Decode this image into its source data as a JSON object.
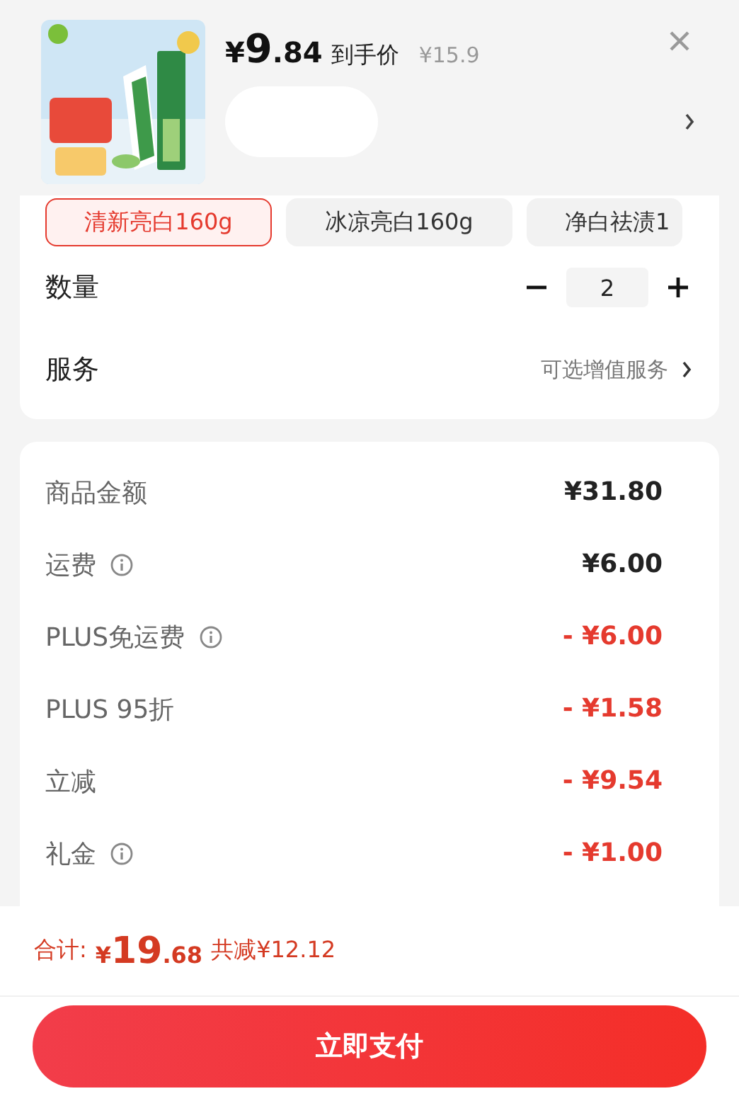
{
  "product": {
    "price_symbol": "¥",
    "price_int": "9",
    "price_dec": ".84",
    "price_label": "到手价",
    "original_price": "¥15.9"
  },
  "variants": [
    {
      "label": "清新亮白160g",
      "selected": true
    },
    {
      "label": "冰凉亮白160g",
      "selected": false
    },
    {
      "label": "净白祛渍1",
      "selected": false
    }
  ],
  "quantity": {
    "label": "数量",
    "value": "2"
  },
  "service": {
    "label": "服务",
    "hint": "可选增值服务"
  },
  "fees": [
    {
      "label": "商品金额",
      "info": false,
      "amount": "¥31.80",
      "discount": false
    },
    {
      "label": "运费",
      "info": true,
      "amount": "¥6.00",
      "discount": false
    },
    {
      "label": "PLUS免运费",
      "info": true,
      "amount": "- ¥6.00",
      "discount": true
    },
    {
      "label": "PLUS 95折",
      "info": false,
      "amount": "- ¥1.58",
      "discount": true
    },
    {
      "label": "立减",
      "info": false,
      "amount": "- ¥9.54",
      "discount": true
    },
    {
      "label": "礼金",
      "info": true,
      "amount": "- ¥1.00",
      "discount": true
    }
  ],
  "total": {
    "label": "合计:",
    "symbol": "¥",
    "int": "19",
    "dec": ".68",
    "saved": "共减¥12.12"
  },
  "pay_button": "立即支付"
}
